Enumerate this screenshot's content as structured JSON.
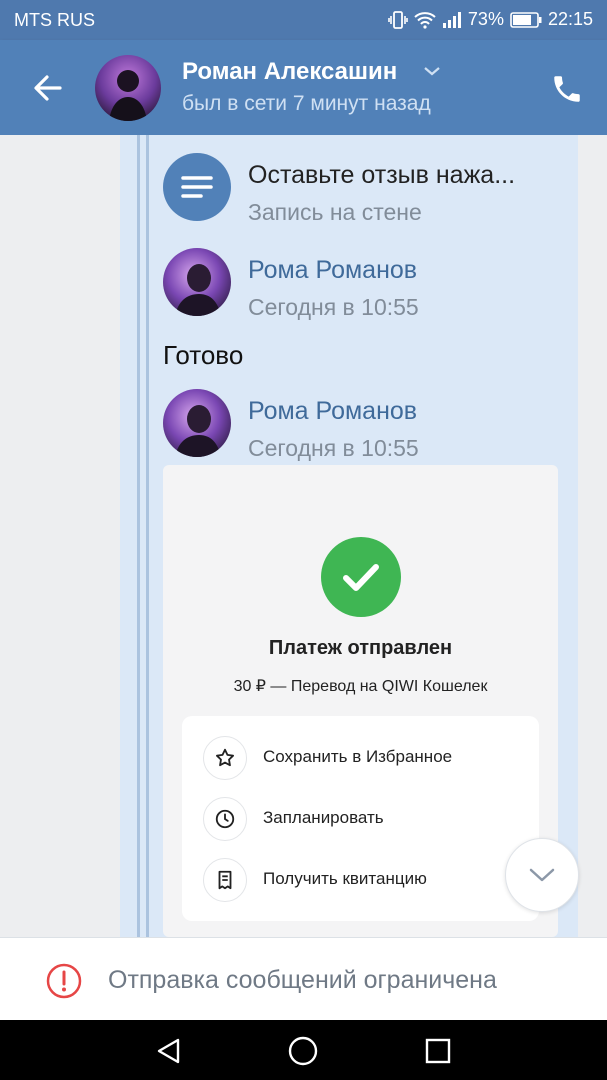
{
  "status_bar": {
    "carrier": "MTS RUS",
    "battery": "73%",
    "time": "22:15"
  },
  "header": {
    "name": "Роман Алексашин",
    "status": "был в сети 7 минут назад"
  },
  "messages": {
    "wall_post": {
      "title": "Оставьте отзыв нажа...",
      "subtitle": "Запись на стене"
    },
    "msg1": {
      "author": "Рома Романов",
      "time": "Сегодня в 10:55"
    },
    "text1": "Готово",
    "msg2": {
      "author": "Рома Романов",
      "time": "Сегодня в 10:55"
    }
  },
  "payment": {
    "title": "Платеж отправлен",
    "subtitle": "30 ₽ — Перевод на QIWI Кошелек",
    "actions": [
      {
        "label": "Сохранить в Избранное",
        "icon": "star-icon"
      },
      {
        "label": "Запланировать",
        "icon": "clock-icon"
      },
      {
        "label": "Получить квитанцию",
        "icon": "receipt-icon"
      }
    ]
  },
  "restriction": {
    "text": "Отправка сообщений ограничена"
  },
  "colors": {
    "header": "#5181b8",
    "accent_green": "#3fb653",
    "warning": "#e64646",
    "bubble": "#dbe8f7"
  }
}
